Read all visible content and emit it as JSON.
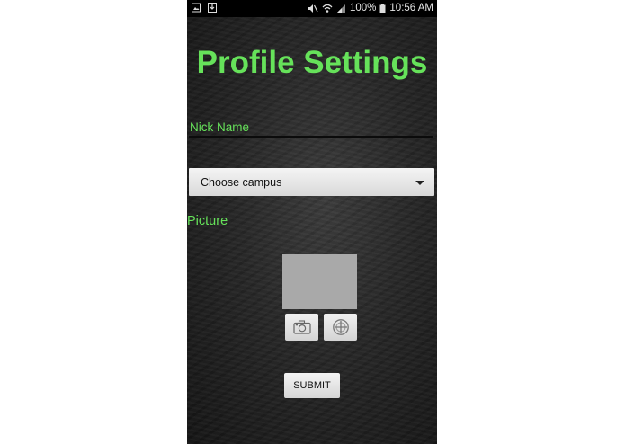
{
  "status_bar": {
    "left_icons": [
      "gallery-icon",
      "download-icon"
    ],
    "right_icons": [
      "mute-icon",
      "wifi-icon",
      "signal-icon",
      "battery-icon"
    ],
    "battery_percent": "100%",
    "time": "10:56 AM"
  },
  "page": {
    "title": "Profile Settings"
  },
  "form": {
    "nickname_label": "Nick Name",
    "nickname_value": "",
    "campus_select_value": "Choose campus",
    "picture_label": "Picture",
    "camera_button_icon": "camera-icon",
    "gallery_button_icon": "add-photo-icon",
    "submit_label": "SUBMIT"
  },
  "colors": {
    "accent_green": "#66e25a",
    "background": "#2a2a2a",
    "button_face": "#e3e3e3",
    "picture_placeholder": "#a9a9a9"
  }
}
